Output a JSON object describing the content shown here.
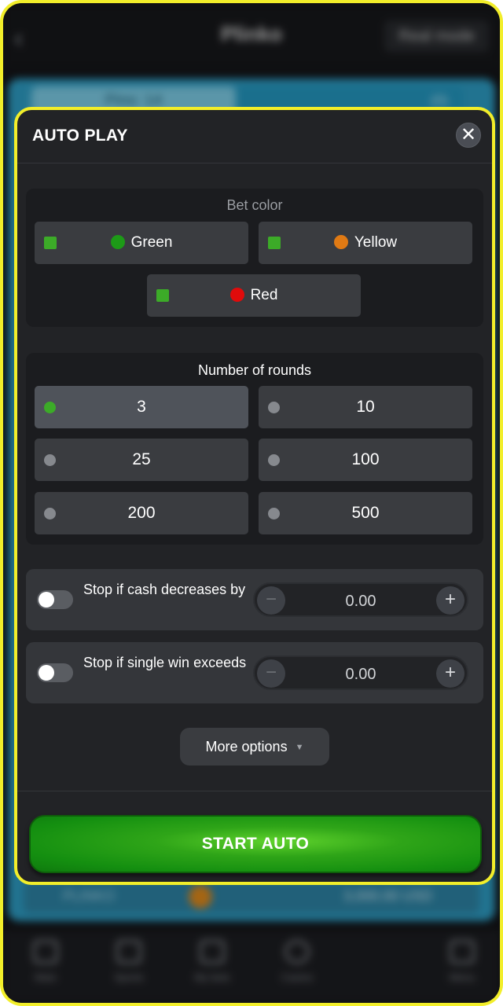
{
  "app": {
    "title": "Plinko",
    "mode_label": "Real mode",
    "pins_label": "Pins: 14",
    "risk_label": "(0)",
    "game_label": "PLINKO",
    "balance_label": "3,000.00 USD"
  },
  "tabbar": {
    "items": [
      "Main",
      "Sports",
      "My bets",
      "Casino",
      "Menu"
    ]
  },
  "modal": {
    "title": "AUTO PLAY",
    "close_glyph": "✕"
  },
  "bet_color": {
    "title": "Bet color",
    "options": [
      {
        "label": "Green",
        "color": "#1d9a17",
        "checked": true
      },
      {
        "label": "Yellow",
        "color": "#e07a14",
        "checked": true
      },
      {
        "label": "Red",
        "color": "#e00b0b",
        "checked": true
      }
    ]
  },
  "rounds": {
    "title": "Number of rounds",
    "options": [
      "3",
      "10",
      "25",
      "100",
      "200",
      "500"
    ],
    "selected": "3"
  },
  "stop_decrease": {
    "label": "Stop if cash decreases by",
    "value": "0.00",
    "minus": "−",
    "plus": "+",
    "enabled": false
  },
  "stop_win": {
    "label": "Stop if single win exceeds",
    "value": "0.00",
    "minus": "−",
    "plus": "+",
    "enabled": false
  },
  "more_options": {
    "label": "More options",
    "caret": "▼"
  },
  "start_button": {
    "label": "START AUTO"
  },
  "colors": {
    "highlight": "#f2ee2a",
    "start_green": "#2fa518",
    "checkbox_green": "#3cab28"
  }
}
